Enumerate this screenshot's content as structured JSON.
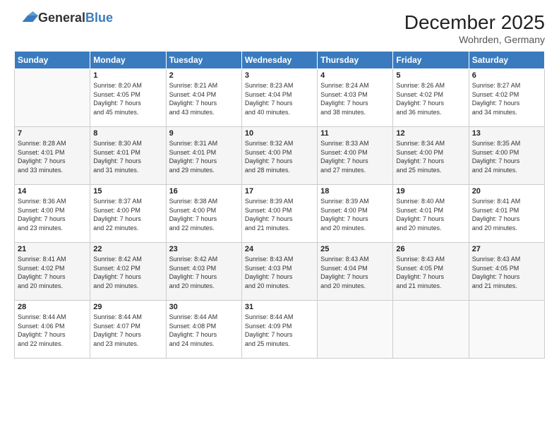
{
  "header": {
    "logo_general": "General",
    "logo_blue": "Blue",
    "month_year": "December 2025",
    "location": "Wohrden, Germany"
  },
  "weekdays": [
    "Sunday",
    "Monday",
    "Tuesday",
    "Wednesday",
    "Thursday",
    "Friday",
    "Saturday"
  ],
  "weeks": [
    [
      {
        "day": "",
        "info": ""
      },
      {
        "day": "1",
        "info": "Sunrise: 8:20 AM\nSunset: 4:05 PM\nDaylight: 7 hours\nand 45 minutes."
      },
      {
        "day": "2",
        "info": "Sunrise: 8:21 AM\nSunset: 4:04 PM\nDaylight: 7 hours\nand 43 minutes."
      },
      {
        "day": "3",
        "info": "Sunrise: 8:23 AM\nSunset: 4:04 PM\nDaylight: 7 hours\nand 40 minutes."
      },
      {
        "day": "4",
        "info": "Sunrise: 8:24 AM\nSunset: 4:03 PM\nDaylight: 7 hours\nand 38 minutes."
      },
      {
        "day": "5",
        "info": "Sunrise: 8:26 AM\nSunset: 4:02 PM\nDaylight: 7 hours\nand 36 minutes."
      },
      {
        "day": "6",
        "info": "Sunrise: 8:27 AM\nSunset: 4:02 PM\nDaylight: 7 hours\nand 34 minutes."
      }
    ],
    [
      {
        "day": "7",
        "info": "Sunrise: 8:28 AM\nSunset: 4:01 PM\nDaylight: 7 hours\nand 33 minutes."
      },
      {
        "day": "8",
        "info": "Sunrise: 8:30 AM\nSunset: 4:01 PM\nDaylight: 7 hours\nand 31 minutes."
      },
      {
        "day": "9",
        "info": "Sunrise: 8:31 AM\nSunset: 4:01 PM\nDaylight: 7 hours\nand 29 minutes."
      },
      {
        "day": "10",
        "info": "Sunrise: 8:32 AM\nSunset: 4:00 PM\nDaylight: 7 hours\nand 28 minutes."
      },
      {
        "day": "11",
        "info": "Sunrise: 8:33 AM\nSunset: 4:00 PM\nDaylight: 7 hours\nand 27 minutes."
      },
      {
        "day": "12",
        "info": "Sunrise: 8:34 AM\nSunset: 4:00 PM\nDaylight: 7 hours\nand 25 minutes."
      },
      {
        "day": "13",
        "info": "Sunrise: 8:35 AM\nSunset: 4:00 PM\nDaylight: 7 hours\nand 24 minutes."
      }
    ],
    [
      {
        "day": "14",
        "info": "Sunrise: 8:36 AM\nSunset: 4:00 PM\nDaylight: 7 hours\nand 23 minutes."
      },
      {
        "day": "15",
        "info": "Sunrise: 8:37 AM\nSunset: 4:00 PM\nDaylight: 7 hours\nand 22 minutes."
      },
      {
        "day": "16",
        "info": "Sunrise: 8:38 AM\nSunset: 4:00 PM\nDaylight: 7 hours\nand 22 minutes."
      },
      {
        "day": "17",
        "info": "Sunrise: 8:39 AM\nSunset: 4:00 PM\nDaylight: 7 hours\nand 21 minutes."
      },
      {
        "day": "18",
        "info": "Sunrise: 8:39 AM\nSunset: 4:00 PM\nDaylight: 7 hours\nand 20 minutes."
      },
      {
        "day": "19",
        "info": "Sunrise: 8:40 AM\nSunset: 4:01 PM\nDaylight: 7 hours\nand 20 minutes."
      },
      {
        "day": "20",
        "info": "Sunrise: 8:41 AM\nSunset: 4:01 PM\nDaylight: 7 hours\nand 20 minutes."
      }
    ],
    [
      {
        "day": "21",
        "info": "Sunrise: 8:41 AM\nSunset: 4:02 PM\nDaylight: 7 hours\nand 20 minutes."
      },
      {
        "day": "22",
        "info": "Sunrise: 8:42 AM\nSunset: 4:02 PM\nDaylight: 7 hours\nand 20 minutes."
      },
      {
        "day": "23",
        "info": "Sunrise: 8:42 AM\nSunset: 4:03 PM\nDaylight: 7 hours\nand 20 minutes."
      },
      {
        "day": "24",
        "info": "Sunrise: 8:43 AM\nSunset: 4:03 PM\nDaylight: 7 hours\nand 20 minutes."
      },
      {
        "day": "25",
        "info": "Sunrise: 8:43 AM\nSunset: 4:04 PM\nDaylight: 7 hours\nand 20 minutes."
      },
      {
        "day": "26",
        "info": "Sunrise: 8:43 AM\nSunset: 4:05 PM\nDaylight: 7 hours\nand 21 minutes."
      },
      {
        "day": "27",
        "info": "Sunrise: 8:43 AM\nSunset: 4:05 PM\nDaylight: 7 hours\nand 21 minutes."
      }
    ],
    [
      {
        "day": "28",
        "info": "Sunrise: 8:44 AM\nSunset: 4:06 PM\nDaylight: 7 hours\nand 22 minutes."
      },
      {
        "day": "29",
        "info": "Sunrise: 8:44 AM\nSunset: 4:07 PM\nDaylight: 7 hours\nand 23 minutes."
      },
      {
        "day": "30",
        "info": "Sunrise: 8:44 AM\nSunset: 4:08 PM\nDaylight: 7 hours\nand 24 minutes."
      },
      {
        "day": "31",
        "info": "Sunrise: 8:44 AM\nSunset: 4:09 PM\nDaylight: 7 hours\nand 25 minutes."
      },
      {
        "day": "",
        "info": ""
      },
      {
        "day": "",
        "info": ""
      },
      {
        "day": "",
        "info": ""
      }
    ]
  ]
}
